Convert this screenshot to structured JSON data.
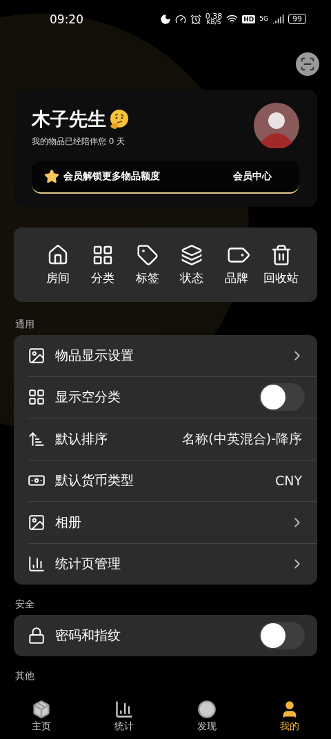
{
  "status_bar": {
    "time": "09:20",
    "net_speed": "0.38",
    "net_unit": "KB/S",
    "hd": "HD",
    "network": "5G",
    "battery": "99"
  },
  "profile": {
    "name": "木子先生",
    "subtitle": "我的物品已经陪伴您 0 天",
    "banner": {
      "text": "会员解锁更多物品额度",
      "action": "会员中心"
    }
  },
  "shortcuts": [
    {
      "label": "房间",
      "kind": "room"
    },
    {
      "label": "分类",
      "kind": "category"
    },
    {
      "label": "标签",
      "kind": "tag"
    },
    {
      "label": "状态",
      "kind": "state"
    },
    {
      "label": "品牌",
      "kind": "brand"
    },
    {
      "label": "回收站",
      "kind": "trash"
    }
  ],
  "sections": [
    {
      "title": "通用",
      "rows": [
        {
          "label": "物品显示设置",
          "kind": "image"
        },
        {
          "label": "显示空分类",
          "kind": "grid",
          "on": false
        },
        {
          "label": "默认排序",
          "kind": "sort",
          "value": "名称(中英混合)-降序"
        },
        {
          "label": "默认货币类型",
          "kind": "currency",
          "value": "CNY"
        },
        {
          "label": "相册",
          "kind": "image"
        },
        {
          "label": "统计页管理",
          "kind": "chart"
        }
      ]
    },
    {
      "title": "安全",
      "rows": [
        {
          "label": "密码和指纹",
          "kind": "lock",
          "on": false
        }
      ]
    },
    {
      "title": "其他"
    }
  ],
  "tabs": [
    {
      "label": "主页",
      "kind": "home",
      "selected": false
    },
    {
      "label": "统计",
      "kind": "stats",
      "selected": false
    },
    {
      "label": "发现",
      "kind": "discover",
      "selected": false
    },
    {
      "label": "我的",
      "kind": "me",
      "selected": true
    }
  ]
}
